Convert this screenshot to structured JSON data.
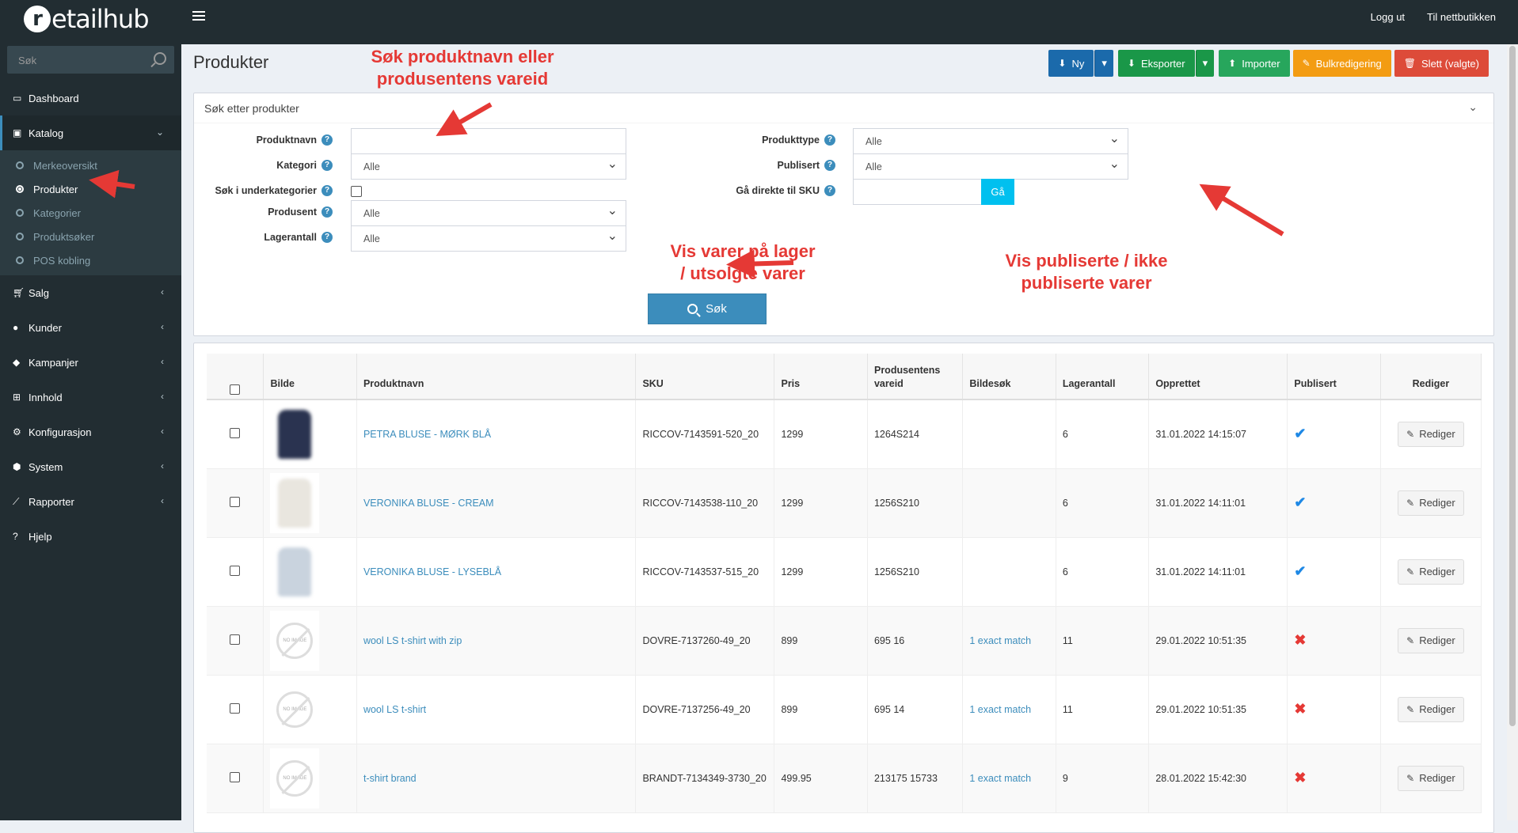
{
  "app": {
    "logo_r": "r",
    "logo_rest": "etailhub"
  },
  "topnav": {
    "logout": "Logg ut",
    "to_store": "Til nettbutikken"
  },
  "sidebar": {
    "search_placeholder": "Søk",
    "items": [
      {
        "label": "Dashboard",
        "icon": "dashboard-icon"
      },
      {
        "label": "Katalog",
        "icon": "book-icon"
      },
      {
        "label": "Salg",
        "icon": "cart-icon"
      },
      {
        "label": "Kunder",
        "icon": "user-icon"
      },
      {
        "label": "Kampanjer",
        "icon": "tags-icon"
      },
      {
        "label": "Innhold",
        "icon": "sitemap-icon"
      },
      {
        "label": "Konfigurasjon",
        "icon": "cogs-icon"
      },
      {
        "label": "System",
        "icon": "cube-icon"
      },
      {
        "label": "Rapporter",
        "icon": "line-chart-icon"
      },
      {
        "label": "Hjelp",
        "icon": "question-icon"
      }
    ],
    "catalog_sub": [
      "Merkeoversikt",
      "Produkter",
      "Kategorier",
      "Produktsøker",
      "POS kobling"
    ]
  },
  "page": {
    "title": "Produkter"
  },
  "actions": {
    "new": "Ny",
    "export": "Eksporter",
    "import": "Importer",
    "bulk": "Bulkredigering",
    "delete": "Slett (valgte)"
  },
  "search_panel": {
    "title": "Søk etter produkter",
    "labels": {
      "product_name": "Produktnavn",
      "category": "Kategori",
      "sub_categories": "Søk i underkategorier",
      "manufacturer": "Produsent",
      "stock": "Lagerantall",
      "product_type": "Produkttype",
      "published": "Publisert",
      "goto_sku": "Gå direkte til SKU"
    },
    "values": {
      "category": "Alle",
      "manufacturer": "Alle",
      "stock": "Alle",
      "product_type": "Alle",
      "published": "Alle"
    },
    "go_button": "Gå",
    "search_button": "Søk"
  },
  "annotations": {
    "a1_line1": "Søk produktnavn eller",
    "a1_line2": "produsentens vareid",
    "a2_line1": "Vis varer på lager",
    "a2_line2": "/ utsolgte varer",
    "a3_line1": "Vis publiserte / ikke",
    "a3_line2": "publiserte varer"
  },
  "table": {
    "headers": {
      "image": "Bilde",
      "name": "Produktnavn",
      "sku": "SKU",
      "price": "Pris",
      "vendor_id_1": "Produsentens",
      "vendor_id_2": "vareid",
      "image_search": "Bildesøk",
      "stock": "Lagerantall",
      "created": "Opprettet",
      "published": "Publisert",
      "edit": "Rediger"
    },
    "edit_label": "Rediger",
    "no_image_label": "NO IMAGE",
    "rows": [
      {
        "name": "PETRA BLUSE - MØRK BLÅ",
        "sku": "RICCOV-7143591-520_20",
        "price": "1299",
        "vendor_id": "1264S214",
        "image_search": "",
        "stock": "6",
        "created": "31.01.2022 14:15:07",
        "published": true,
        "img": "navy"
      },
      {
        "name": "VERONIKA BLUSE - CREAM",
        "sku": "RICCOV-7143538-110_20",
        "price": "1299",
        "vendor_id": "1256S210",
        "image_search": "",
        "stock": "6",
        "created": "31.01.2022 14:11:01",
        "published": true,
        "img": "cream"
      },
      {
        "name": "VERONIKA BLUSE - LYSEBLÅ",
        "sku": "RICCOV-7143537-515_20",
        "price": "1299",
        "vendor_id": "1256S210",
        "image_search": "",
        "stock": "6",
        "created": "31.01.2022 14:11:01",
        "published": true,
        "img": "lightblue"
      },
      {
        "name": "wool LS t-shirt with zip",
        "sku": "DOVRE-7137260-49_20",
        "price": "899",
        "vendor_id": "695 16",
        "image_search": "1 exact match",
        "stock": "11",
        "created": "29.01.2022 10:51:35",
        "published": false,
        "img": "none"
      },
      {
        "name": "wool LS t-shirt",
        "sku": "DOVRE-7137256-49_20",
        "price": "899",
        "vendor_id": "695 14",
        "image_search": "1 exact match",
        "stock": "11",
        "created": "29.01.2022 10:51:35",
        "published": false,
        "img": "none"
      },
      {
        "name": "t-shirt brand",
        "sku": "BRANDT-7134349-3730_20",
        "price": "499.95",
        "vendor_id": "213175 15733",
        "image_search": "1 exact match",
        "stock": "9",
        "created": "28.01.2022 15:42:30",
        "published": false,
        "img": "none"
      }
    ]
  },
  "colors": {
    "navy": "#2a3350",
    "cream": "#e9e6df",
    "lightblue": "#c9d3de"
  }
}
